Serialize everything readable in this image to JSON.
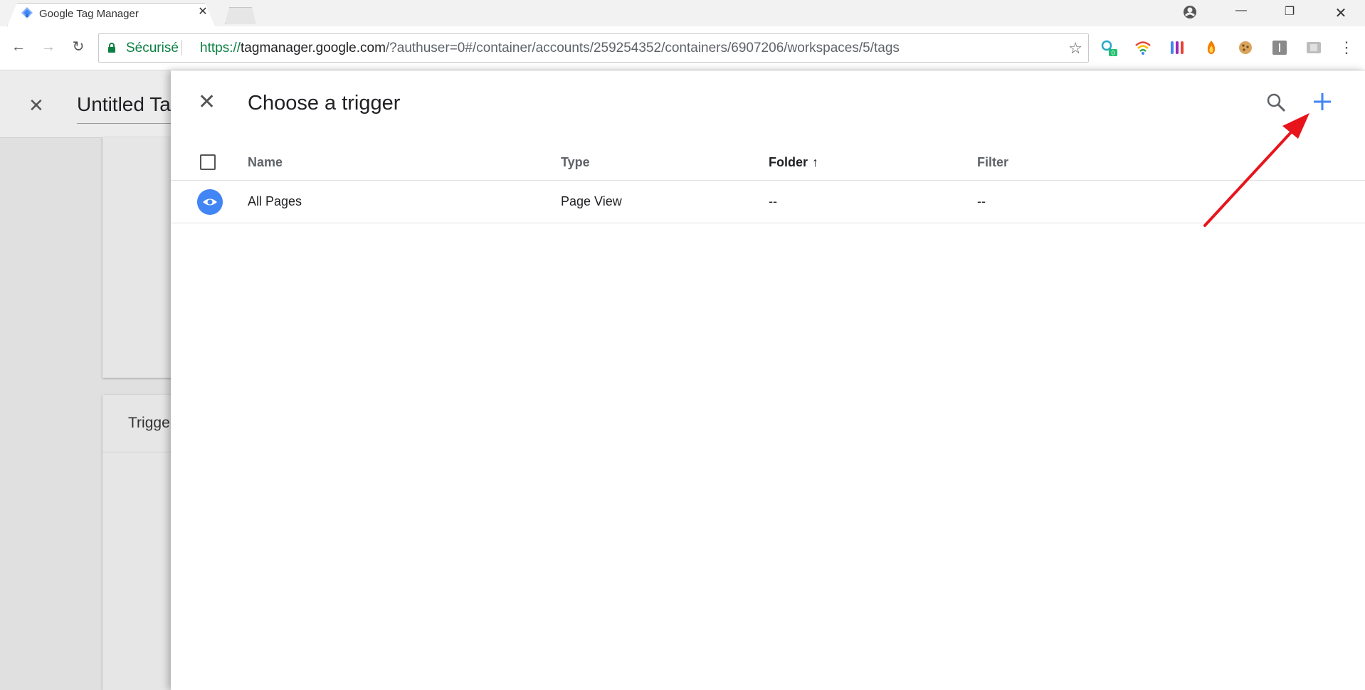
{
  "browser": {
    "tab_title": "Google Tag Manager",
    "secure_label": "Sécurisé",
    "url_protocol": "https://",
    "url_host": "tagmanager.google.com",
    "url_path": "/?authuser=0#/container/accounts/259254352/containers/6907206/workspaces/5/tags",
    "extension_badge": "0"
  },
  "background_page": {
    "title": "Untitled Ta",
    "card_label": "Trigge"
  },
  "panel": {
    "title": "Choose a trigger",
    "columns": {
      "name": "Name",
      "type": "Type",
      "folder": "Folder",
      "filter": "Filter"
    },
    "rows": [
      {
        "name": "All Pages",
        "type": "Page View",
        "folder": "--",
        "filter": "--"
      }
    ]
  },
  "colors": {
    "accent": "#4285f4",
    "secure_green": "#0b8043",
    "annotation_red": "#e8141c"
  }
}
